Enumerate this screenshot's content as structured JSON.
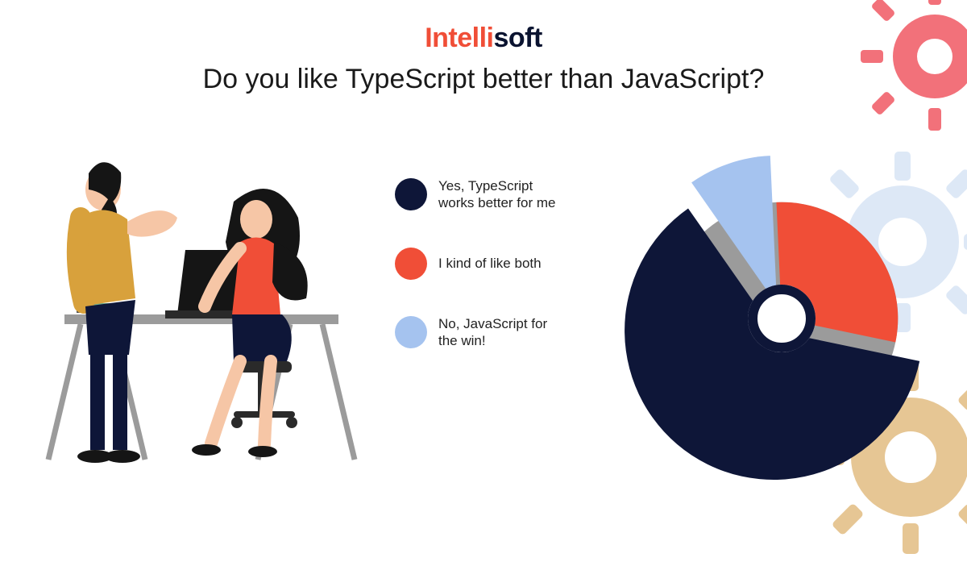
{
  "brand": {
    "part1": "Intelli",
    "part2": "soft"
  },
  "title": "Do you like TypeScript better than JavaScript?",
  "legend": [
    {
      "label": "Yes, TypeScript works better for me",
      "color": "#0e1638"
    },
    {
      "label": "I kind of like both",
      "color": "#f04e37"
    },
    {
      "label": "No, JavaScript for the win!",
      "color": "#a5c3ef"
    }
  ],
  "colors": {
    "dark": "#0e1638",
    "red": "#f04e37",
    "lightblue": "#a5c3ef",
    "gray": "#9b9b9b",
    "gear_red": "#f2717a",
    "gear_tan": "#e6c694"
  },
  "chart_data": {
    "type": "pie",
    "title": "Do you like TypeScript better than JavaScript?",
    "series": [
      {
        "name": "Yes, TypeScript works better for me",
        "value": 62,
        "color": "#0e1638",
        "exploded": true
      },
      {
        "name": "I kind of like both",
        "value": 29,
        "color": "#f04e37",
        "exploded": false
      },
      {
        "name": "No, JavaScript for the win!",
        "value": 9,
        "color": "#a5c3ef",
        "exploded": true
      }
    ],
    "notes": "Values are estimated from slice angles (no numeric labels on source). All slices share a thin gray background ring; 'Yes' and 'No' slices are exploded outward slightly; a white donut hole with dark ring sits at center."
  }
}
